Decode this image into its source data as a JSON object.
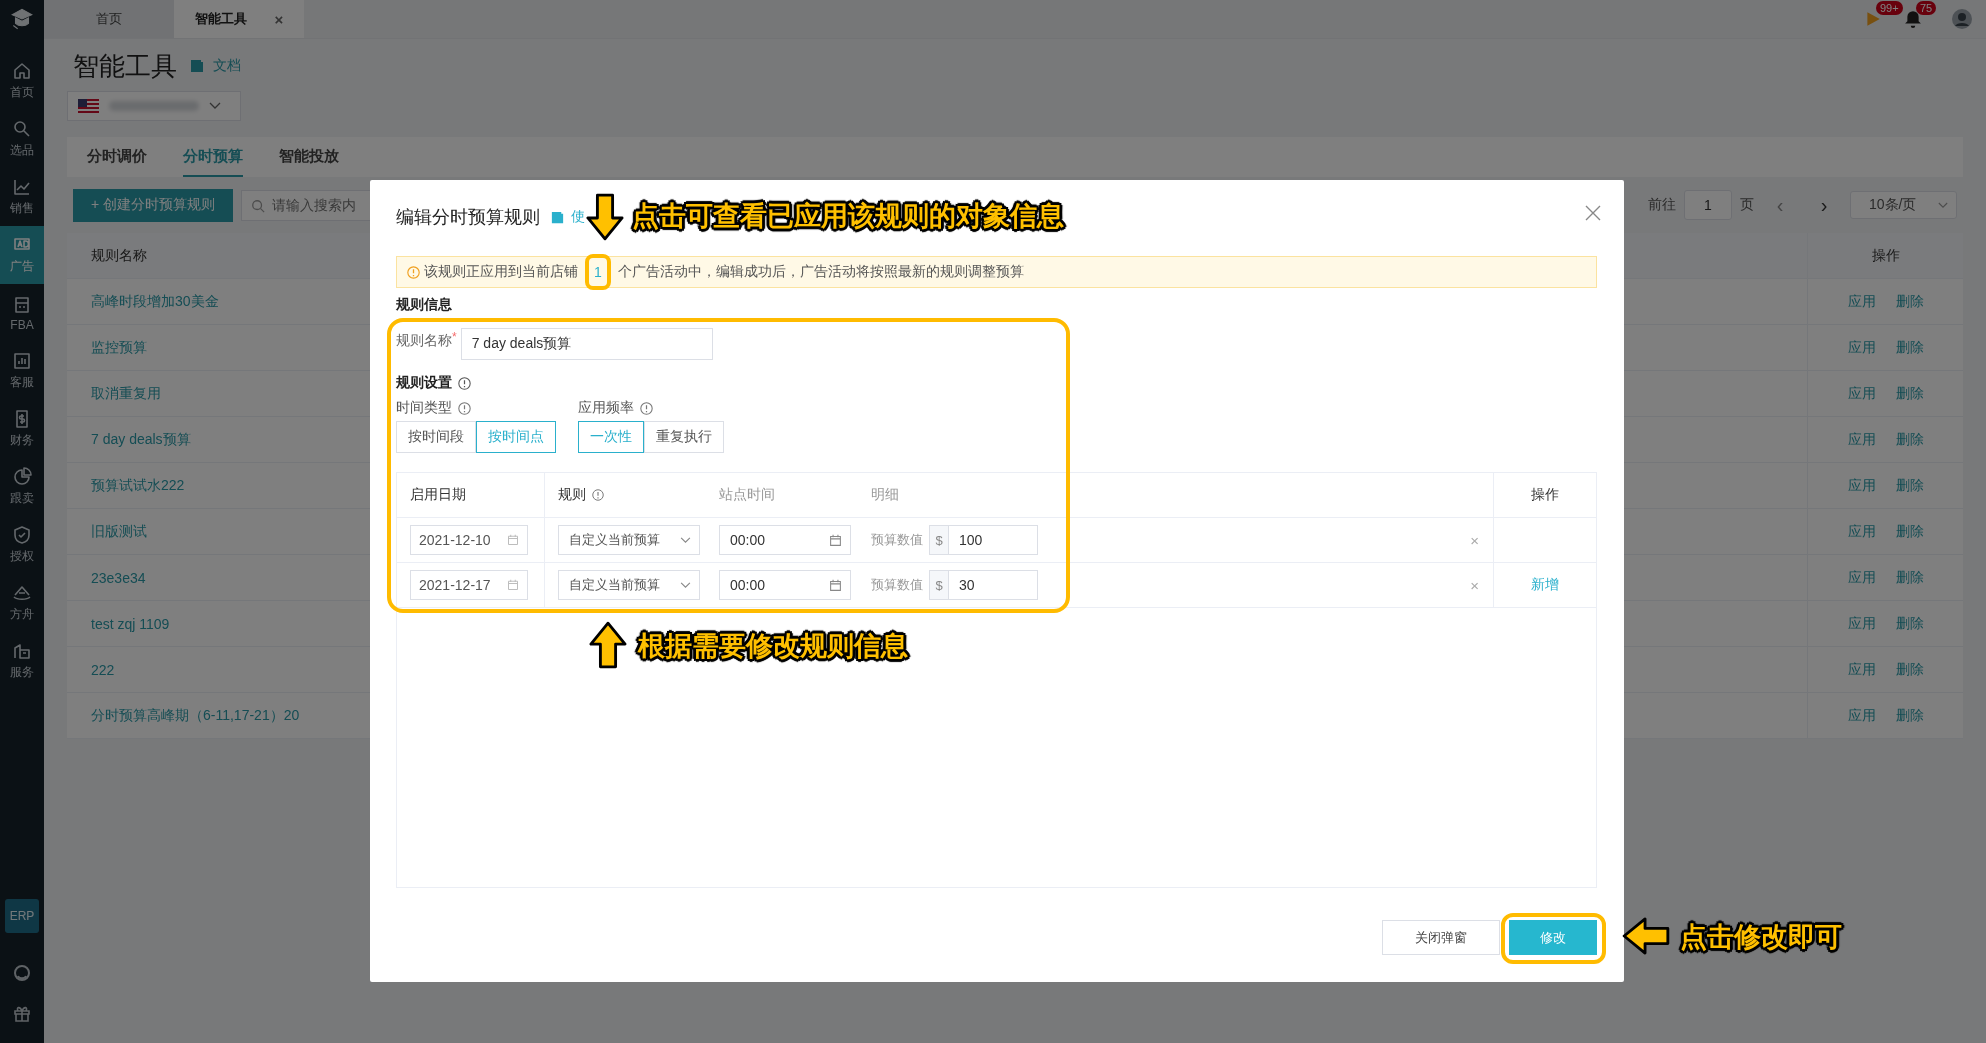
{
  "top_bar": {
    "tabs": [
      {
        "label": "首页",
        "selected": false
      },
      {
        "label": "智能工具",
        "selected": true,
        "close": "×"
      }
    ],
    "badges": [
      {
        "count": "99+"
      },
      {
        "count": "75"
      }
    ]
  },
  "sidebar": {
    "items": [
      {
        "label": "首页",
        "selected": false
      },
      {
        "label": "选品",
        "selected": false
      },
      {
        "label": "销售",
        "selected": false
      },
      {
        "label": "广告",
        "selected": true
      },
      {
        "label": "FBA",
        "selected": false
      },
      {
        "label": "客服",
        "selected": false
      },
      {
        "label": "财务",
        "selected": false
      },
      {
        "label": "跟卖",
        "selected": false
      },
      {
        "label": "授权",
        "selected": false
      },
      {
        "label": "方舟",
        "selected": false
      },
      {
        "label": "服务",
        "selected": false
      }
    ],
    "erp": "ERP"
  },
  "page": {
    "title": "智能工具",
    "doc_link": "文档",
    "tabs": [
      {
        "label": "分时调价",
        "selected": false
      },
      {
        "label": "分时预算",
        "selected": true
      },
      {
        "label": "智能投放",
        "selected": false
      }
    ],
    "create_button": "+ 创建分时预算规则",
    "search": {
      "placeholder": "请输入搜索内"
    },
    "pagination": {
      "goto_label": "前往",
      "page": "1",
      "page_suffix": "页",
      "prev": "‹",
      "next": "›",
      "page_size": "10条/页"
    },
    "table": {
      "columns": [
        "规则名称",
        "操作"
      ],
      "rows": [
        {
          "name": "高峰时段增加30美金",
          "actions": [
            "应用",
            "删除"
          ]
        },
        {
          "name": "监控预算",
          "actions": [
            "应用",
            "删除"
          ]
        },
        {
          "name": "取消重复用",
          "actions": [
            "应用",
            "删除"
          ]
        },
        {
          "name": "7 day deals预算",
          "actions": [
            "应用",
            "删除"
          ]
        },
        {
          "name": "预算试试水222",
          "actions": [
            "应用",
            "删除"
          ]
        },
        {
          "name": "旧版测试",
          "actions": [
            "应用",
            "删除"
          ]
        },
        {
          "name": "23e3e34",
          "actions": [
            "应用",
            "删除"
          ]
        },
        {
          "name": "test  zqj  1109",
          "actions": [
            "应用",
            "删除"
          ]
        },
        {
          "name": "222",
          "actions": [
            "应用",
            "删除"
          ]
        },
        {
          "name": "分时预算高峰期（6-11,17-21）20",
          "actions": [
            "应用",
            "删除"
          ]
        }
      ]
    }
  },
  "modal": {
    "title": "编辑分时预算规则",
    "help_link": "使",
    "alert": {
      "before": "该规则正应用到当前店铺",
      "count": "1",
      "after": "个广告活动中，编辑成功后，广告活动将按照最新的规则调整预算"
    },
    "section_title": "规则信息",
    "name_field": {
      "label": "规则名称",
      "required": "*",
      "value": "7 day deals预算"
    },
    "settings_title": "规则设置",
    "time_type": {
      "label": "时间类型",
      "options": [
        {
          "label": "按时间段",
          "selected": false
        },
        {
          "label": "按时间点",
          "selected": true
        }
      ]
    },
    "frequency": {
      "label": "应用频率",
      "options": [
        {
          "label": "一次性",
          "selected": true
        },
        {
          "label": "重复执行",
          "selected": false
        }
      ]
    },
    "rules_table": {
      "columns": [
        "启用日期",
        "规则",
        "站点时间",
        "明细",
        "操作"
      ],
      "rows": [
        {
          "date": "2021-12-10",
          "rule": "自定义当前预算",
          "time": "00:00",
          "detail_label": "预算数值",
          "currency": "$",
          "value": "100",
          "remove": "×"
        },
        {
          "date": "2021-12-17",
          "rule": "自定义当前预算",
          "time": "00:00",
          "detail_label": "预算数值",
          "currency": "$",
          "value": "30",
          "remove": "×",
          "action": "新增"
        }
      ]
    },
    "buttons": [
      {
        "label": "关闭弹窗",
        "kind": "secondary"
      },
      {
        "label": "修改",
        "kind": "primary"
      }
    ]
  },
  "annotations": [
    {
      "text": "点击可查看已应用该规则的对象信息",
      "kind": "down"
    },
    {
      "text": "根据需要修改规则信息",
      "kind": "up"
    },
    {
      "text": "点击修改即可",
      "kind": "left"
    }
  ]
}
